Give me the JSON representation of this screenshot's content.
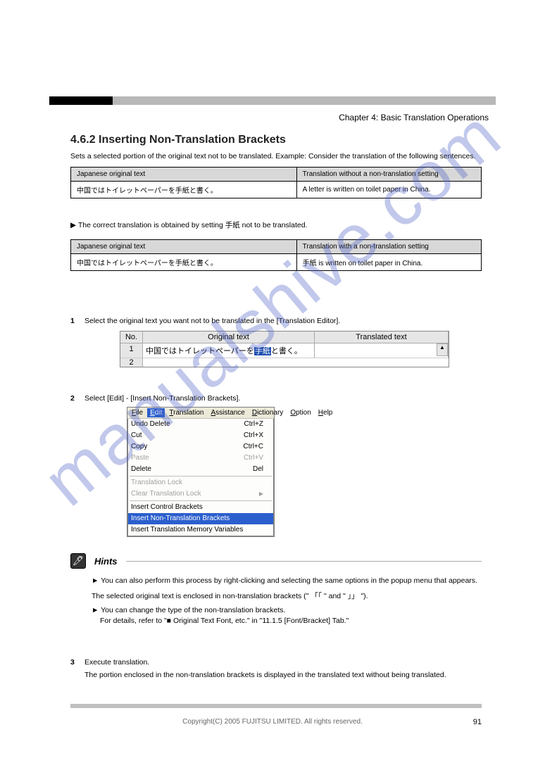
{
  "chapter_label": "Chapter 4: Basic Translation Operations",
  "section_title": "4.6.2 Inserting Non-Translation Brackets",
  "intro": "Sets a selected portion of the original text not to be translated. Example: Consider the translation of the following sentences.",
  "table1": {
    "h1": "Japanese original text",
    "h2": "Translation without a non-translation setting",
    "r1": "中国ではトイレットペーパーを手紙と書く。",
    "r2": "A letter is written on toilet paper in China."
  },
  "angle_text": "The correct translation is obtained by setting 手紙 not to be translated.",
  "table2": {
    "h1": "Japanese original text",
    "h2": "Translation with a non-translation setting",
    "r1": "中国ではトイレットペーパーを手紙と書く。",
    "r2": "手紙 is written on toilet paper in China."
  },
  "step1": {
    "num": "1",
    "text": "Select the original text you want not to be translated in the [Translation Editor]."
  },
  "grid": {
    "no_label": "No.",
    "orig_label": "Original text",
    "trans_label": "Translated text",
    "row_no": "1",
    "row_text_pre": "中国ではトイレットペーパーを",
    "row_text_hl": "手紙",
    "row_text_post": "と書く。",
    "row2_no": "2"
  },
  "step2": {
    "num": "2",
    "text": "Select [Edit] - [Insert Non-Translation Brackets]."
  },
  "menu": {
    "bar": [
      "File",
      "Edit",
      "Translation",
      "Assistance",
      "Dictionary",
      "Option",
      "Help"
    ],
    "items_g1": [
      {
        "label": "Undo Delete",
        "accel": "Ctrl+Z"
      },
      {
        "label": "Cut",
        "accel": "Ctrl+X"
      },
      {
        "label": "Copy",
        "accel": "Ctrl+C"
      },
      {
        "label": "Paste",
        "accel": "Ctrl+V",
        "disabled": true
      },
      {
        "label": "Delete",
        "accel": "Del"
      }
    ],
    "items_g2": [
      {
        "label": "Translation Lock",
        "disabled": true
      },
      {
        "label": "Clear Translation Lock",
        "arrow": true,
        "disabled": true
      }
    ],
    "items_g3": [
      {
        "label": "Insert Control Brackets"
      },
      {
        "label": "Insert Non-Translation Brackets",
        "hl": true
      },
      {
        "label": "Insert Translation Memory Variables"
      }
    ]
  },
  "hints": {
    "label": "Hints",
    "lines": [
      "► You can also perform this process by right-clicking and selecting the same options in the popup menu that appears.",
      "The selected original text is enclosed in non-translation brackets (\" 「「 \" and \" 」」 \").",
      "► You can change the type of the non-translation brackets.",
      "For details, refer to \"■ Original Text Font, etc.\" in \"11.1.5 [Font/Bracket] Tab.\""
    ]
  },
  "step3": {
    "num": "3",
    "title": "Execute translation.",
    "detail": "The portion enclosed in the non-translation brackets is displayed in the translated text without being translated."
  },
  "footer": {
    "copyright": "Copyright(C) 2005 FUJITSU LIMITED. All rights reserved.",
    "page": "91"
  }
}
